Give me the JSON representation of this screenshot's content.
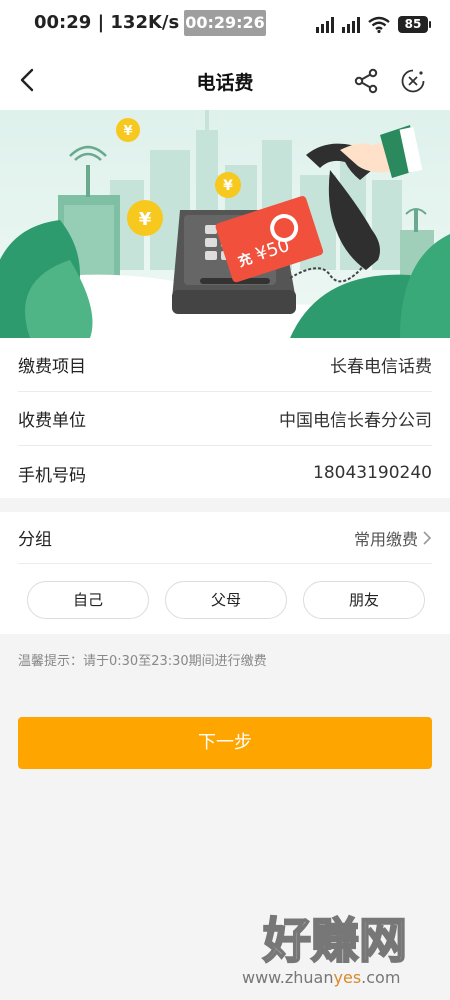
{
  "status_bar": {
    "time": "00:29 | 132K/s",
    "timer": "00:29:26",
    "battery": "85"
  },
  "nav": {
    "title": "电话费",
    "icons": [
      "back-arrow-icon",
      "share-icon",
      "close-icon"
    ]
  },
  "banner": {
    "card_char": "充",
    "card_amount": "¥50",
    "coin_symbol": "¥"
  },
  "info": {
    "rows": [
      {
        "label": "缴费项目",
        "value": "长春电信话费"
      },
      {
        "label": "收费单位",
        "value": "中国电信长春分公司"
      },
      {
        "label": "手机号码",
        "value": "18043190240"
      }
    ]
  },
  "group": {
    "label": "分组",
    "value": "常用缴费",
    "chips": [
      "自己",
      "父母",
      "朋友"
    ]
  },
  "tip": "温馨提示：请于0:30至23:30期间进行缴费",
  "next_button": "下一步",
  "watermark": {
    "text": "好赚网",
    "url_part1": "www.zhuan",
    "url_part2": "yes",
    "url_part3": ".com"
  },
  "colors": {
    "accent": "#ffa500",
    "green": "#3aa97a",
    "red_card": "#f0503c",
    "coin": "#f7c81e"
  }
}
